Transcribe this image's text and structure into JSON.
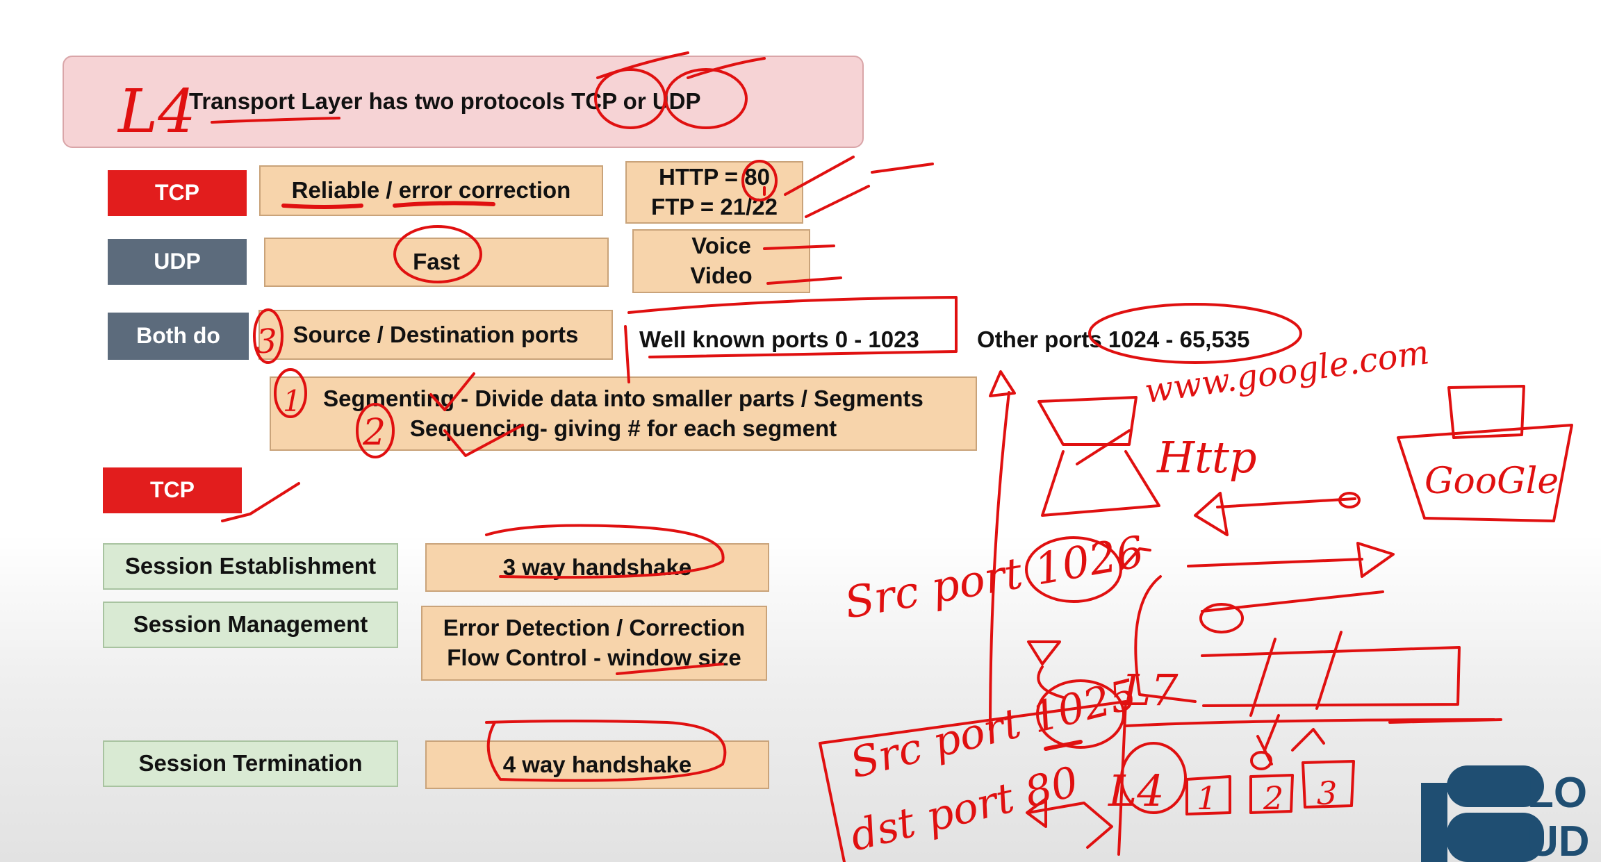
{
  "title": {
    "text": "Transport Layer has two protocols TCP or UDP"
  },
  "rows": {
    "tcp_label": "TCP",
    "tcp_desc": "Reliable / error correction",
    "tcp_ports": [
      "HTTP = 80",
      "FTP = 21/22"
    ],
    "udp_label": "UDP",
    "udp_desc": "Fast",
    "udp_uses": [
      "Voice",
      "Video"
    ],
    "both_label": "Both do",
    "both_desc": "Source / Destination ports",
    "well_known": "Well known ports 0 - 1023",
    "other_ports": "Other ports 1024 - 65,535",
    "segmenting": [
      "Segmenting - Divide data into smaller parts / Segments",
      "Sequencing- giving # for each segment"
    ]
  },
  "tcp_section": {
    "label": "TCP",
    "session_establishment": "Session Establishment",
    "establishment_desc": "3 way handshake",
    "session_management": "Session Management",
    "management_desc": [
      "Error Detection / Correction",
      "Flow Control - window size"
    ],
    "session_termination": "Session Termination",
    "termination_desc": "4 way handshake"
  },
  "handwriting": {
    "l4_title": "L4",
    "num_3": "3",
    "num_1": "1",
    "num_2": "2",
    "www": "www.google.com",
    "http": "Http",
    "google": "GooGle",
    "src_port_1026": "Src port 1026",
    "src_port_1025": "Src port 1025",
    "dst_port": "dst port 80",
    "l7": "L7",
    "l4": "L4",
    "seg1": "1",
    "seg2": "2",
    "seg3": "3"
  },
  "logo": {
    "text_top": "LO",
    "text_bottom": "UD"
  },
  "colors": {
    "ink": "#e01010",
    "tcp_red": "#e21d1d",
    "label_gray": "#5c6b7c",
    "peach": "#f7d4ab",
    "green": "#d9ead3",
    "title_pink": "#f6d3d5",
    "logo_blue": "#1f4e72"
  }
}
